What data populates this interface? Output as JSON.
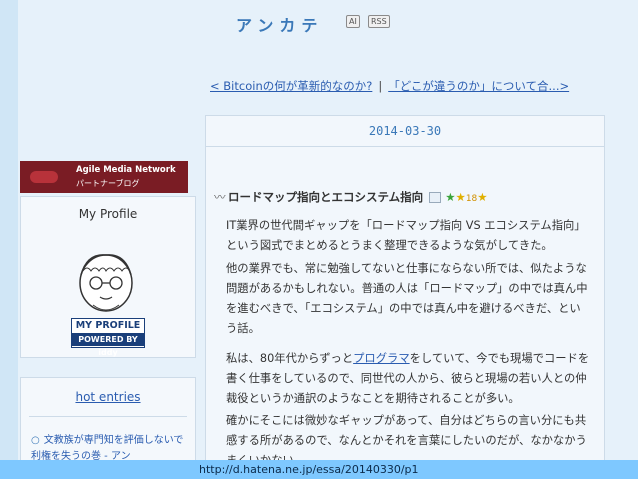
{
  "header": {
    "site_title": "アンカテ",
    "badge_ai": "AI",
    "badge_rss": "RSS"
  },
  "pager": {
    "prev": "< Bitcoinの何が革新的なのか?",
    "separator": "|",
    "next": "「どこが違うのか」について合...>"
  },
  "entry": {
    "date": "2014-03-30",
    "swirl": "〰",
    "title": "ロードマップ指向とエコシステム指向",
    "star_count": "18",
    "paragraphs": [
      "IT業界の世代間ギャップを「ロードマップ指向 VS エコシステム指向」という図式でまとめるとうまく整理できるような気がしてきた。",
      "他の業界でも、常に勉強してないと仕事にならない所では、似たような問題があるかもしれない。普通の人は「ロードマップ」の中では真ん中を進むべきで、「エコシステム」の中では真ん中を避けるべきだ、という話。"
    ],
    "p3_before": "私は、80年代からずっと",
    "p3_link": "プログラマ",
    "p3_after": "をしていて、今でも現場でコードを書く仕事をしているので、同世代の人から、彼らと現場の若い人との仲裁役というか通訳のようなことを期待されることが多い。",
    "p4": "確かにそこには微妙なギャップがあって、自分はどちらの言い分にも共感する所があるので、なんとかそれを言葉にしたいのだが、なかなかうまくいかない。"
  },
  "sidebar": {
    "banner_line1": "Agile Media Network",
    "banner_line2": "パートナーブログ",
    "profile_title": "My Profile",
    "myprofile_label": "MY PROFILE",
    "myprofile_powered": "POWERED BY iddy",
    "hot_title": "hot entries",
    "hot_item": "文教族が専門知を評価しないで利権を失うの巻 - アン"
  },
  "url": "http://d.hatena.ne.jp/essa/20140330/p1",
  "colors": {
    "accent": "#3a78b8",
    "link": "#2a5cb0",
    "banner": "#7a1c24",
    "url_bar": "#7ec8ff"
  }
}
